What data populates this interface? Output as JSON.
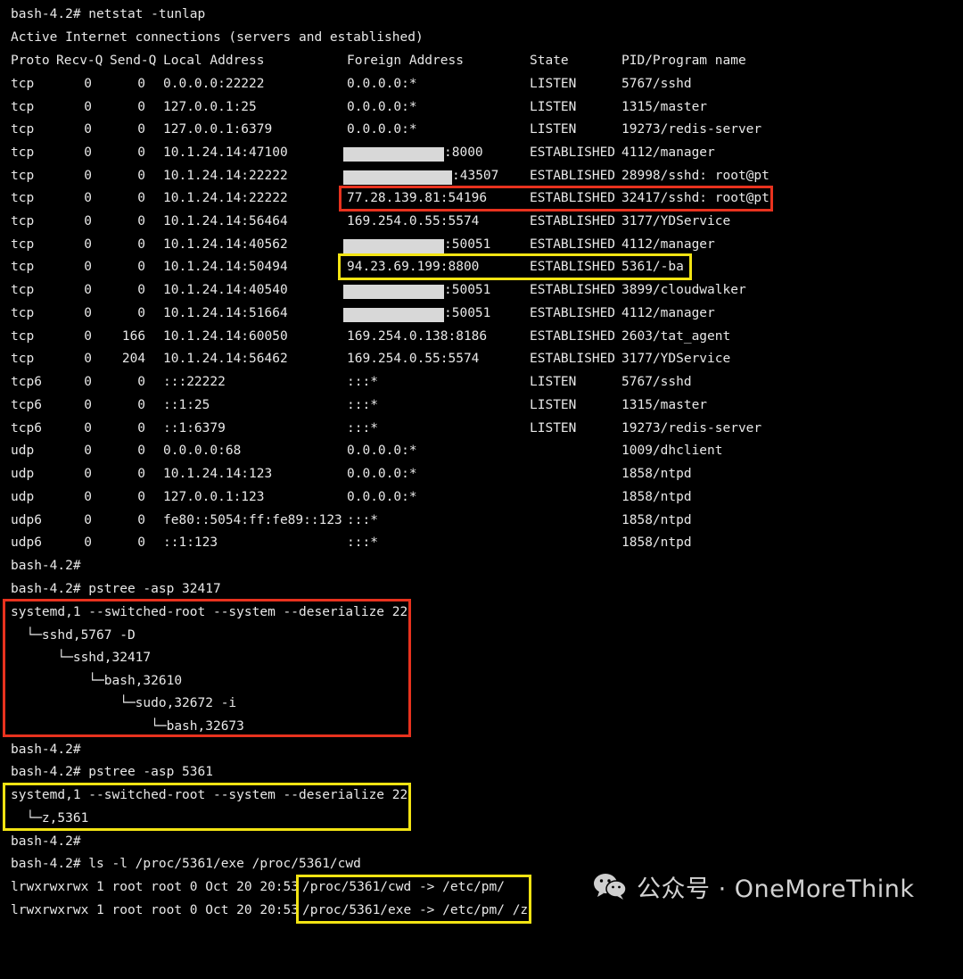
{
  "terminal": {
    "cmd_netstat": "bash-4.2# netstat -tunlap",
    "netstat_title": "Active Internet connections (servers and established)",
    "headers": [
      "Proto",
      "Recv-Q",
      "Send-Q",
      "Local Address",
      "Foreign Address",
      "State",
      "PID/Program name"
    ],
    "rows": [
      [
        "tcp",
        "0",
        "0",
        "0.0.0.0:22222",
        "0.0.0.0:*",
        "LISTEN",
        "5767/sshd"
      ],
      [
        "tcp",
        "0",
        "0",
        "127.0.0.1:25",
        "0.0.0.0:*",
        "LISTEN",
        "1315/master"
      ],
      [
        "tcp",
        "0",
        "0",
        "127.0.0.1:6379",
        "0.0.0.0:*",
        "LISTEN",
        "19273/redis-server"
      ],
      [
        "tcp",
        "0",
        "0",
        "10.1.24.14:47100",
        ":8000",
        "ESTABLISHED",
        "4112/manager"
      ],
      [
        "tcp",
        "0",
        "0",
        "10.1.24.14:22222",
        ":43507",
        "ESTABLISHED",
        "28998/sshd: root@pt"
      ],
      [
        "tcp",
        "0",
        "0",
        "10.1.24.14:22222",
        "77.28.139.81:54196",
        "ESTABLISHED",
        "32417/sshd: root@pt"
      ],
      [
        "tcp",
        "0",
        "0",
        "10.1.24.14:56464",
        "169.254.0.55:5574",
        "ESTABLISHED",
        "3177/YDService"
      ],
      [
        "tcp",
        "0",
        "0",
        "10.1.24.14:40562",
        ":50051",
        "ESTABLISHED",
        "4112/manager"
      ],
      [
        "tcp",
        "0",
        "0",
        "10.1.24.14:50494",
        "94.23.69.199:8800",
        "ESTABLISHED",
        "5361/-ba"
      ],
      [
        "tcp",
        "0",
        "0",
        "10.1.24.14:40540",
        ":50051",
        "ESTABLISHED",
        "3899/cloudwalker"
      ],
      [
        "tcp",
        "0",
        "0",
        "10.1.24.14:51664",
        ":50051",
        "ESTABLISHED",
        "4112/manager"
      ],
      [
        "tcp",
        "0",
        "166",
        "10.1.24.14:60050",
        "169.254.0.138:8186",
        "ESTABLISHED",
        "2603/tat_agent"
      ],
      [
        "tcp",
        "0",
        "204",
        "10.1.24.14:56462",
        "169.254.0.55:5574",
        "ESTABLISHED",
        "3177/YDService"
      ],
      [
        "tcp6",
        "0",
        "0",
        ":::22222",
        ":::*",
        "LISTEN",
        "5767/sshd"
      ],
      [
        "tcp6",
        "0",
        "0",
        "::1:25",
        ":::*",
        "LISTEN",
        "1315/master"
      ],
      [
        "tcp6",
        "0",
        "0",
        "::1:6379",
        ":::*",
        "LISTEN",
        "19273/redis-server"
      ],
      [
        "udp",
        "0",
        "0",
        "0.0.0.0:68",
        "0.0.0.0:*",
        "",
        "1009/dhclient"
      ],
      [
        "udp",
        "0",
        "0",
        "10.1.24.14:123",
        "0.0.0.0:*",
        "",
        "1858/ntpd"
      ],
      [
        "udp",
        "0",
        "0",
        "127.0.0.1:123",
        "0.0.0.0:*",
        "",
        "1858/ntpd"
      ],
      [
        "udp6",
        "0",
        "0",
        "fe80::5054:ff:fe89::123",
        ":::*",
        "",
        "1858/ntpd"
      ],
      [
        "udp6",
        "0",
        "0",
        "::1:123",
        ":::*",
        "",
        "1858/ntpd"
      ]
    ],
    "prompt_1": "bash-4.2#",
    "cmd_pstree_1": "bash-4.2# pstree -asp 32417",
    "tree_1": [
      "systemd,1 --switched-root --system --deserialize 22",
      "  └─sshd,5767 -D",
      "      └─sshd,32417",
      "          └─bash,32610",
      "              └─sudo,32672 -i",
      "                  └─bash,32673"
    ],
    "prompt_2": "bash-4.2#",
    "cmd_pstree_2": "bash-4.2# pstree -asp 5361",
    "tree_2": [
      "systemd,1 --switched-root --system --deserialize 22",
      "  └─z,5361"
    ],
    "prompt_3": "bash-4.2#",
    "cmd_ls": "bash-4.2# ls -l /proc/5361/exe /proc/5361/cwd",
    "ls_rows": [
      {
        "perms": "lrwxrwxrwx 1 root root 0 Oct 20 20:53",
        "link": "/proc/5361/cwd -> /etc/pm/"
      },
      {
        "perms": "lrwxrwxrwx 1 root root 0 Oct 20 20:53",
        "link": "/proc/5361/exe -> /etc/pm/ /z"
      }
    ]
  },
  "watermark": {
    "icon": "wechat-icon",
    "text": "公众号 · OneMoreThink"
  },
  "colors": {
    "background": "#000000",
    "text": "#e8e8e8",
    "highlight_red": "#e8321e",
    "highlight_yellow": "#f2e313",
    "redaction": "#d8d8d8"
  }
}
